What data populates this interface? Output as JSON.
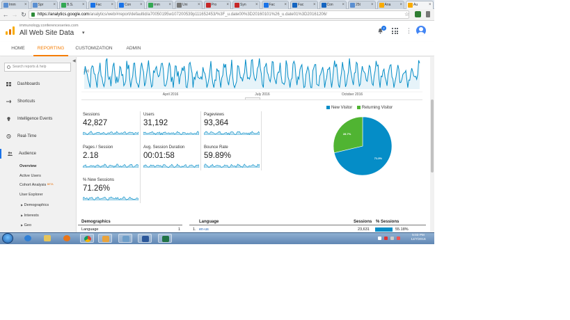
{
  "browser": {
    "tabs": [
      {
        "label": "Imm",
        "color": "#5b8fd1"
      },
      {
        "label": "Spr",
        "color": "#5b8fd1"
      },
      {
        "label": "B.S.",
        "color": "#34a853"
      },
      {
        "label": "Fac",
        "color": "#1a73e8"
      },
      {
        "label": "Con",
        "color": "#1a73e8"
      },
      {
        "label": "imm",
        "color": "#34a853"
      },
      {
        "label": "Uni",
        "color": "#777777"
      },
      {
        "label": "Pro",
        "color": "#c62828"
      },
      {
        "label": "Syn",
        "color": "#c62828"
      },
      {
        "label": "Fac",
        "color": "#1a73e8"
      },
      {
        "label": "Fac",
        "color": "#1565c0"
      },
      {
        "label": "Con",
        "color": "#1565c0"
      },
      {
        "label": "25t",
        "color": "#5b8fd1"
      },
      {
        "label": "Ana",
        "color": "#f9ab00"
      },
      {
        "label": "Au",
        "color": "#f9ab00"
      }
    ],
    "url_host": "https://analytics.google.com",
    "url_path": "/analytics/web/#report/defaultid/a70050195w107200539p111652453/%3F_u.date00%3D20160101%26_u.date01%3D20161206/"
  },
  "header": {
    "account": "immunology.conferenceseries.com",
    "property": "All Web Site Data",
    "notifications": "2"
  },
  "topnav": [
    "HOME",
    "REPORTING",
    "CUSTOMIZATION",
    "ADMIN"
  ],
  "sidebar": {
    "search_placeholder": "Search reports & help",
    "items": [
      "Dashboards",
      "Shortcuts",
      "Intelligence Events",
      "Real-Time",
      "Audience"
    ],
    "audience_sub": {
      "overview": "Overview",
      "active_users": "Active Users",
      "cohort": "Cohort Analysis",
      "beta": "BETA",
      "user_explorer": "User Explorer",
      "demographics": "Demographics",
      "interests": "Interests",
      "geo": "Geo"
    }
  },
  "chart_top": {
    "y_label": "200",
    "x_labels": [
      "April 2016",
      "July 2016",
      "October 2016"
    ]
  },
  "metrics": [
    {
      "label": "Sessions",
      "value": "42,827"
    },
    {
      "label": "Users",
      "value": "31,192"
    },
    {
      "label": "Pageviews",
      "value": "93,364"
    },
    {
      "label": "Pages / Session",
      "value": "2.18"
    },
    {
      "label": "Avg. Session Duration",
      "value": "00:01:58"
    },
    {
      "label": "Bounce Rate",
      "value": "59.89%"
    },
    {
      "label": "% New Sessions",
      "value": "71.26%"
    }
  ],
  "chart_data": {
    "type": "pie",
    "labels": [
      "New Visitor",
      "Returning Visitor"
    ],
    "values": [
      71.3,
      28.7
    ],
    "slice_labels": [
      "71.3%",
      "28.7%"
    ],
    "colors": [
      "#058dc7",
      "#50b432"
    ],
    "legend_position": "top"
  },
  "tables": {
    "left_header": "Demographics",
    "left_first_row": "Language",
    "left_first_num": "1",
    "right_header_language": "Language",
    "right_header_sessions": "Sessions",
    "right_header_pct": "% Sessions",
    "row_index": "1.",
    "row_lang": "en-us",
    "row_sessions": "23,631",
    "row_pct": "55.18%"
  },
  "taskbar": {
    "time": "5:03 PM",
    "date": "12/7/2016"
  }
}
